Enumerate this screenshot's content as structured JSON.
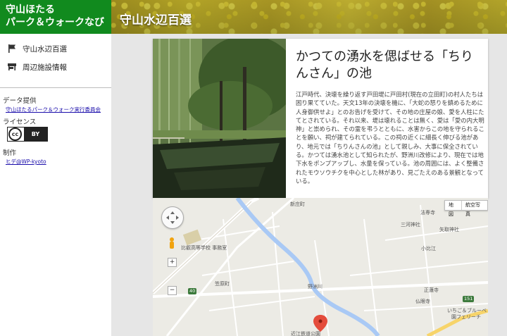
{
  "site": {
    "title_line1": "守山ほたる",
    "title_line2": "パーク＆ウォークなび"
  },
  "banner": {
    "title": "守山水辺百選"
  },
  "sidebar": {
    "items": [
      {
        "label": "守山水辺百選",
        "icon": "flag-icon"
      },
      {
        "label": "周辺施設情報",
        "icon": "store-icon"
      }
    ],
    "data_provider_label": "データ提供",
    "data_provider_link": "守山ほたるパーク＆ウォーク実行委員会",
    "license_label": "ライセンス",
    "license_badge_left": "cc",
    "license_badge_right": "BY",
    "credit_label": "制作",
    "credit_link": "ヒデ@WP-kyoto"
  },
  "article": {
    "title": "かつての湧水を偲ばせる「ちりんさん」の池",
    "body": "江戸時代、決壊を繰り返す戸田堤に戸田村(現在の立田町)の村人たちは困り果てていた。天文13年の決壊を機に、「大蛇の怒りを鎮めるために人身御供せよ」とのお告げを受けて、その地の庄屋の娘、愛を人柱にたてとされている。それ以来、堤は壊れることは無く、愛は「愛の内大明神」と崇められ、その霊を弔うとともに、水害からこの地を守られることを願い、祠が建てられている。この祠の近くに細長く伸びる池があり、地元では「ちりんさんの池」として親しみ、大事に保全されている。かつては湧水池として知られたが、野洲川改修により、現在では地下水をポンプアップし、水量を保っている。池の周囲には、よく整備されたモウソウチクを中心とした林があり、見ごたえのある景観となっている。"
  },
  "map": {
    "type_buttons": [
      "地図",
      "航空写真"
    ],
    "zoom_in": "+",
    "zoom_out": "−",
    "labels": [
      "新庄町",
      "法専寺",
      "三河神社",
      "矢取神社",
      "小比江",
      "比叡高等学校 事務室",
      "笠原町",
      "野洲川",
      "正蓮寺",
      "仏眼寺",
      "いちご＆ブルーベ",
      "園フェリーチ",
      "近江鉄道公園"
    ],
    "route_badges": [
      "40",
      "151"
    ],
    "colors": {
      "river": "#a9c9f5",
      "road": "#ffffff",
      "pin": "#e44c3c"
    }
  }
}
